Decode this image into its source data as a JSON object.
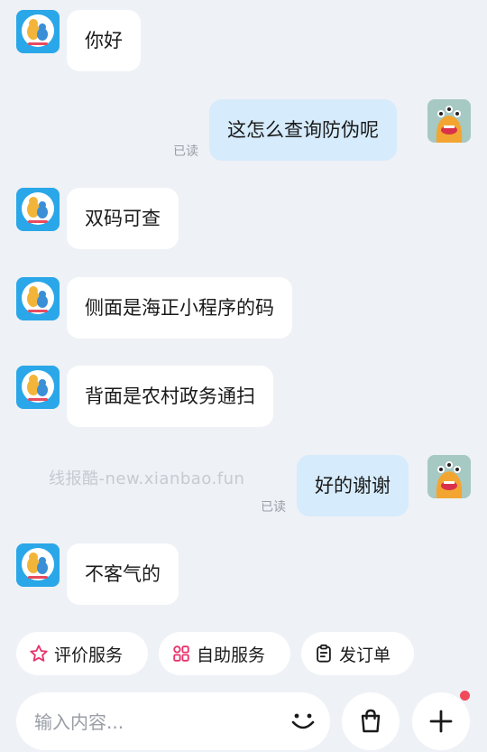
{
  "messages": [
    {
      "side": "in",
      "text": "你好"
    },
    {
      "side": "out",
      "text": "这怎么查询防伪呢",
      "status": "已读"
    },
    {
      "side": "in",
      "text": "双码可查"
    },
    {
      "side": "in",
      "text": "侧面是海正小程序的码"
    },
    {
      "side": "in",
      "text": "背面是农村政务通扫"
    },
    {
      "side": "out",
      "text": "好的谢谢",
      "status": "已读"
    },
    {
      "side": "in",
      "text": "不客气的"
    }
  ],
  "watermark": "线报酷-new.xianbao.fun",
  "quick_actions": [
    {
      "label": "评价服务",
      "icon": "star-icon"
    },
    {
      "label": "自助服务",
      "icon": "grid-icon"
    },
    {
      "label": "发订单",
      "icon": "clipboard-icon"
    }
  ],
  "input": {
    "placeholder": "输入内容..."
  },
  "colors": {
    "accent": "#e8336b",
    "outgoing_bubble": "#d6ebfb",
    "incoming_bubble": "#ffffff",
    "badge": "#f04a5a"
  }
}
